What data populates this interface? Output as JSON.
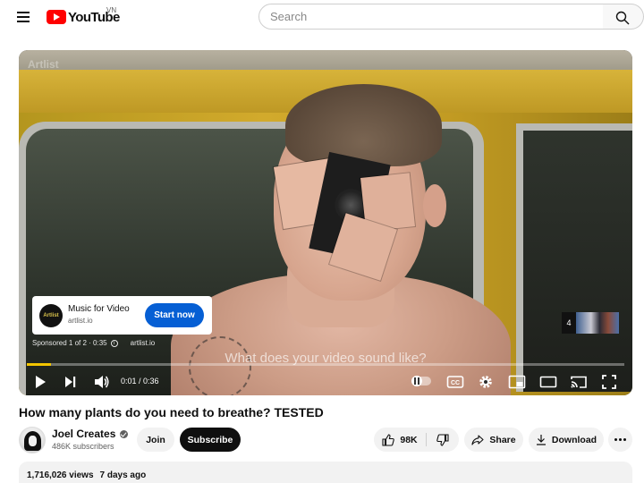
{
  "header": {
    "logo_text": "YouTube",
    "country_code": "VN",
    "search_placeholder": "Search"
  },
  "player": {
    "watermark": "Artlist",
    "caption": "What does your video sound like?",
    "progress_fraction": 0.04,
    "time_current": "0:01",
    "time_separator": " / ",
    "time_total": "0:36",
    "progress_color": "#f3c500",
    "ad": {
      "logo_text": "Artlist",
      "title": "Music for Video",
      "url": "artlist.io",
      "cta_label": "Start now",
      "cta_color": "#065fd4",
      "sponsored_text": "Sponsored 1 of 2 · 0:35",
      "meta_url": "artlist.io",
      "thumb_count": "4"
    },
    "controls": {
      "play": "play-icon",
      "next": "next-icon",
      "volume": "volume-icon",
      "autoplay": "autoplay-toggle",
      "cc": "CC",
      "settings": "gear-icon",
      "miniplayer": "miniplayer-icon",
      "theater": "theater-icon",
      "cast": "cast-icon",
      "fullscreen": "fullscreen-icon"
    }
  },
  "video": {
    "title": "How many plants do you need to breathe? TESTED",
    "channel_name": "Joel Creates",
    "subscribers": "486K subscribers",
    "join_label": "Join",
    "subscribe_label": "Subscribe",
    "like_count": "98K",
    "share_label": "Share",
    "download_label": "Download",
    "views": "1,716,026 views",
    "age": "7 days ago"
  }
}
